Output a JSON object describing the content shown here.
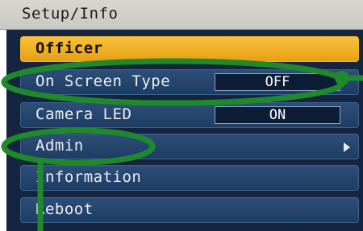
{
  "header": {
    "title": "Setup/Info"
  },
  "menu": {
    "items": [
      {
        "label": "Officer",
        "selected": true
      },
      {
        "label": "On Screen Type",
        "value": "OFF"
      },
      {
        "label": "Camera LED",
        "value": "ON"
      },
      {
        "label": "Admin",
        "has_submenu": true
      },
      {
        "label": "Information"
      },
      {
        "label": "Reboot"
      }
    ]
  },
  "colors": {
    "highlight": "#f4b328",
    "panel": "#16253f",
    "annotation": "#1f8a2c"
  },
  "icons": {
    "submenu": "chevron-right-icon"
  }
}
